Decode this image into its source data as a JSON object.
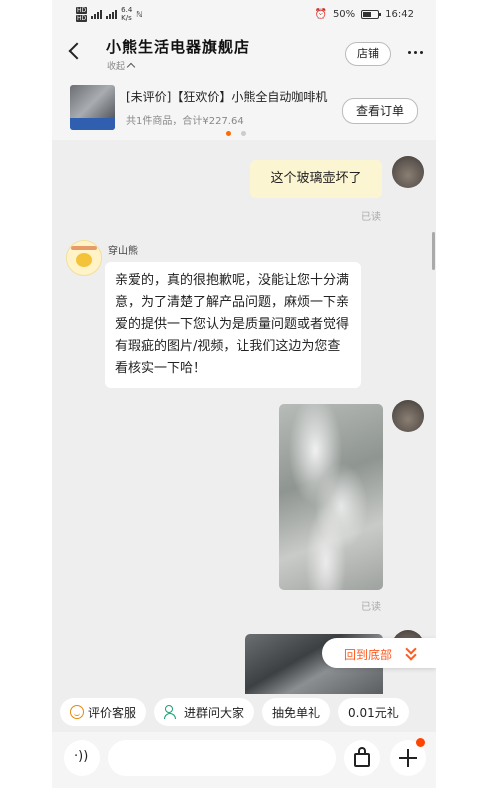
{
  "status_bar": {
    "hd1": "HD",
    "hd2": "HD",
    "net_speed_value": "6.4",
    "net_speed_unit": "K/s",
    "battery": "50%",
    "time": "16:42"
  },
  "header": {
    "store_name": "小熊生活电器旗舰店",
    "collapse_label": "收起",
    "store_button": "店铺"
  },
  "order": {
    "title": "[未评价]【狂欢价】小熊全自动咖啡机",
    "summary": "共1件商品，合计¥227.64",
    "view_order": "查看订单",
    "carousel_pages": 2,
    "carousel_active": 0
  },
  "messages": {
    "m1_text": "这个玻璃壶坏了",
    "m1_status": "已读",
    "seller_name": "穿山熊",
    "m2_text": "亲爱的，真的很抱歉呢，没能让您十分满意，为了清楚了解产品问题，麻烦一下亲爱的提供一下您认为是质量问题或者觉得有瑕疵的图片/视频，让我们这边为您查看核实一下哈！",
    "m3_status": "已读"
  },
  "back_to_bottom": "回到底部",
  "quick_replies": [
    "评价客服",
    "进群问大家",
    "抽免单礼",
    "0.01元礼"
  ],
  "input": {
    "voice_glyph": "·))"
  },
  "colors": {
    "accent": "#ff5a1f",
    "outgoing_bubble": "#fcf5d2",
    "page_bg": "#eeeeee"
  },
  "icons": [
    "back-arrow-icon",
    "more-icon",
    "smile-icon",
    "people-icon",
    "voice-icon",
    "emoji-icon",
    "shopping-bag-icon",
    "plus-icon"
  ]
}
